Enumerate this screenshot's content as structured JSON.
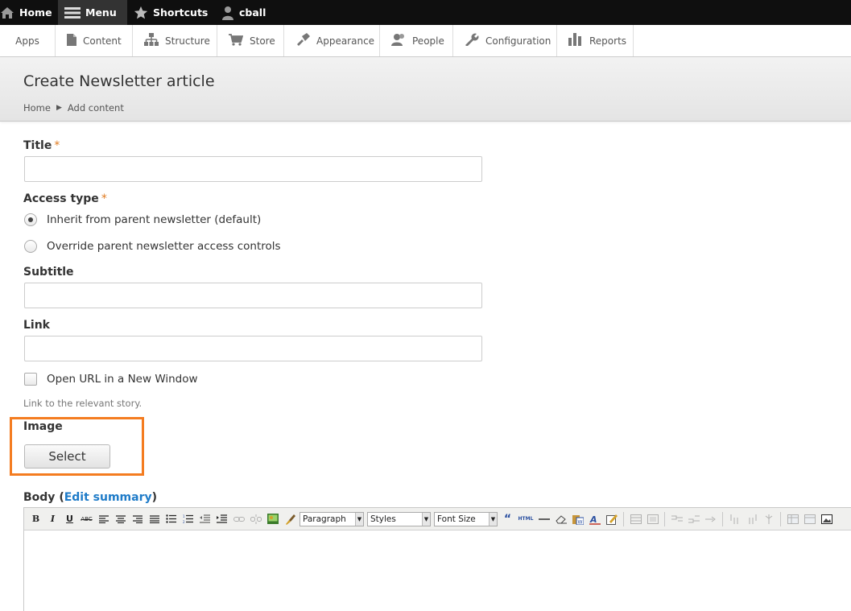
{
  "toolbar": {
    "home": "Home",
    "menu": "Menu",
    "shortcuts": "Shortcuts",
    "user": "cball"
  },
  "tray": {
    "items": [
      "Apps",
      "Content",
      "Structure",
      "Store",
      "Appearance",
      "People",
      "Configuration",
      "Reports"
    ]
  },
  "header": {
    "title": "Create Newsletter article",
    "breadcrumb": [
      "Home",
      "Add content"
    ]
  },
  "form": {
    "title_label": "Title",
    "required_mark": "*",
    "title_value": "",
    "access_label": "Access type",
    "access_options": [
      {
        "label": "Inherit from parent newsletter (default)",
        "selected": true
      },
      {
        "label": "Override parent newsletter access controls",
        "selected": false
      }
    ],
    "subtitle_label": "Subtitle",
    "subtitle_value": "",
    "link_label": "Link",
    "link_value": "",
    "new_window_label": "Open URL in a New Window",
    "new_window_checked": false,
    "link_help": "Link to the relevant story.",
    "image_label": "Image",
    "select_button": "Select",
    "body_label": "Body",
    "edit_summary": "Edit summary",
    "paren_open": "(",
    "paren_close": ")"
  },
  "editor": {
    "format_select": "Paragraph",
    "styles_select": "Styles",
    "fontsize_select": "Font Size",
    "bold": "B",
    "italic": "I",
    "underline": "U",
    "strike": "ABC",
    "html": "HTML"
  },
  "colors": {
    "accent_required": "#e07b20",
    "highlight": "#f47c20",
    "link": "#1e7bc8"
  }
}
